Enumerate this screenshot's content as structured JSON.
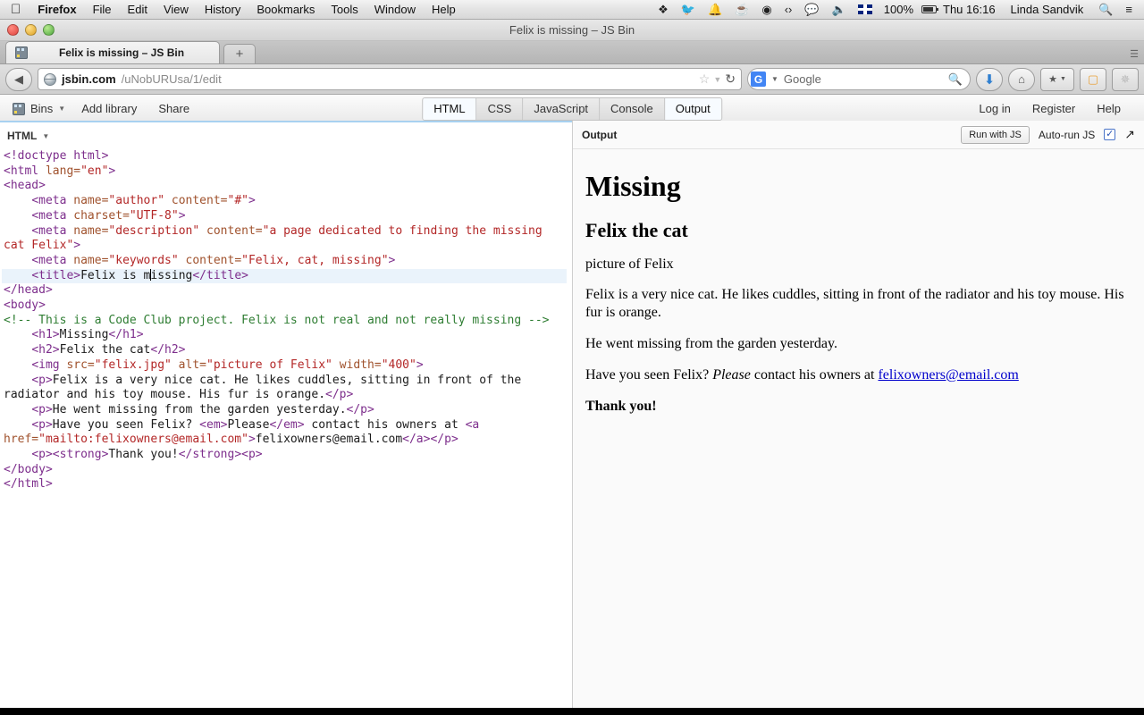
{
  "menubar": {
    "apple_icon": "apple-logo",
    "app_name": "Firefox",
    "items": [
      "File",
      "Edit",
      "View",
      "History",
      "Bookmarks",
      "Tools",
      "Window",
      "Help"
    ],
    "status_icons": [
      "dropbox-icon",
      "twitter-icon",
      "bell-icon",
      "coffee-icon",
      "wifi-icon",
      "code-icon",
      "messages-icon",
      "volume-icon"
    ],
    "input_flag": "uk-flag-icon",
    "battery_percent": "100%",
    "clock": "Thu 16:16",
    "user_name": "Linda Sandvik",
    "search_icon": "spotlight-search-icon",
    "notifications_icon": "notification-center-icon"
  },
  "window": {
    "title": "Felix is missing – JS Bin",
    "tab": {
      "title": "Felix is missing – JS Bin",
      "favicon": "jsbin-favicon"
    },
    "new_tab_label": "+",
    "list_all_tabs": "list-all-tabs-icon"
  },
  "navbar": {
    "back_icon": "back-arrow-icon",
    "site_icon": "globe-icon",
    "url_host": "jsbin.com",
    "url_path": "/uNobURUsa/1/edit",
    "bookmark_icon": "star-icon",
    "bookmark_dropdown_icon": "chevron-down-icon",
    "reload_icon": "reload-icon",
    "search_engine": "G",
    "search_placeholder": "Google",
    "search_value": "",
    "search_submit_icon": "magnifier-icon",
    "downloads_icon": "download-arrow-icon",
    "home_icon": "home-icon",
    "bookmarks_menu_icon": "bookmarks-star-icon",
    "bookmarks_menu_caret": "chevron-down-icon",
    "reader_icon": "reader-ruler-icon",
    "addon_icon": "addon-spinner-icon"
  },
  "jsbin": {
    "bins_label": "Bins",
    "bins_icon": "jsbin-logo-icon",
    "bins_caret": "caret-down-icon",
    "add_library_label": "Add library",
    "share_label": "Share",
    "panel_tabs": [
      {
        "label": "HTML",
        "active": true
      },
      {
        "label": "CSS",
        "active": false
      },
      {
        "label": "JavaScript",
        "active": false
      },
      {
        "label": "Console",
        "active": false
      },
      {
        "label": "Output",
        "active": true
      }
    ],
    "login_label": "Log in",
    "register_label": "Register",
    "help_label": "Help"
  },
  "editor": {
    "panel_label": "HTML",
    "panel_caret": "caret-down-icon",
    "lines": [
      [
        {
          "t": "tag",
          "s": "<!doctype html>"
        }
      ],
      [
        {
          "t": "tag",
          "s": "<html "
        },
        {
          "t": "attr",
          "s": "lang="
        },
        {
          "t": "str",
          "s": "\"en\""
        },
        {
          "t": "tag",
          "s": ">"
        }
      ],
      [
        {
          "t": "tag",
          "s": "<head>"
        }
      ],
      [
        {
          "t": "txt",
          "s": "    "
        },
        {
          "t": "tag",
          "s": "<meta "
        },
        {
          "t": "attr",
          "s": "name="
        },
        {
          "t": "str",
          "s": "\"author\""
        },
        {
          "t": "attr",
          "s": " content="
        },
        {
          "t": "str",
          "s": "\"#\""
        },
        {
          "t": "tag",
          "s": ">"
        }
      ],
      [
        {
          "t": "txt",
          "s": "    "
        },
        {
          "t": "tag",
          "s": "<meta "
        },
        {
          "t": "attr",
          "s": "charset="
        },
        {
          "t": "str",
          "s": "\"UTF-8\""
        },
        {
          "t": "tag",
          "s": ">"
        }
      ],
      [
        {
          "t": "txt",
          "s": "    "
        },
        {
          "t": "tag",
          "s": "<meta "
        },
        {
          "t": "attr",
          "s": "name="
        },
        {
          "t": "str",
          "s": "\"description\""
        },
        {
          "t": "attr",
          "s": " content="
        },
        {
          "t": "str",
          "s": "\"a page dedicated to finding the missing cat Felix\""
        },
        {
          "t": "tag",
          "s": ">"
        }
      ],
      [
        {
          "t": "txt",
          "s": "    "
        },
        {
          "t": "tag",
          "s": "<meta "
        },
        {
          "t": "attr",
          "s": "name="
        },
        {
          "t": "str",
          "s": "\"keywords\""
        },
        {
          "t": "attr",
          "s": " content="
        },
        {
          "t": "str",
          "s": "\"Felix, cat, missing\""
        },
        {
          "t": "tag",
          "s": ">"
        }
      ],
      [
        {
          "t": "txt",
          "s": "    "
        },
        {
          "t": "tag",
          "s": "<title>"
        },
        {
          "t": "txt",
          "s": "Felix is m"
        },
        {
          "t": "caret",
          "s": ""
        },
        {
          "t": "txt",
          "s": "issing"
        },
        {
          "t": "tag",
          "s": "</title>"
        }
      ],
      [
        {
          "t": "tag",
          "s": "</head>"
        }
      ],
      [
        {
          "t": "tag",
          "s": "<body>"
        }
      ],
      [
        {
          "t": "cmt",
          "s": "<!-- This is a Code Club project. Felix is not real and not really missing -->"
        }
      ],
      [
        {
          "t": "txt",
          "s": "    "
        },
        {
          "t": "tag",
          "s": "<h1>"
        },
        {
          "t": "txt",
          "s": "Missing"
        },
        {
          "t": "tag",
          "s": "</h1>"
        }
      ],
      [
        {
          "t": "txt",
          "s": "    "
        },
        {
          "t": "tag",
          "s": "<h2>"
        },
        {
          "t": "txt",
          "s": "Felix the cat"
        },
        {
          "t": "tag",
          "s": "</h2>"
        }
      ],
      [
        {
          "t": "txt",
          "s": "    "
        },
        {
          "t": "tag",
          "s": "<img "
        },
        {
          "t": "attr",
          "s": "src="
        },
        {
          "t": "str",
          "s": "\"felix.jpg\""
        },
        {
          "t": "attr",
          "s": " alt="
        },
        {
          "t": "str",
          "s": "\"picture of Felix\""
        },
        {
          "t": "attr",
          "s": " width="
        },
        {
          "t": "str",
          "s": "\"400\""
        },
        {
          "t": "tag",
          "s": ">"
        }
      ],
      [
        {
          "t": "txt",
          "s": "    "
        },
        {
          "t": "tag",
          "s": "<p>"
        },
        {
          "t": "txt",
          "s": "Felix is a very nice cat. He likes cuddles, sitting in front of the radiator and his toy mouse. His fur is orange."
        },
        {
          "t": "tag",
          "s": "</p>"
        }
      ],
      [
        {
          "t": "txt",
          "s": "    "
        },
        {
          "t": "tag",
          "s": "<p>"
        },
        {
          "t": "txt",
          "s": "He went missing from the garden yesterday."
        },
        {
          "t": "tag",
          "s": "</p>"
        }
      ],
      [
        {
          "t": "txt",
          "s": "    "
        },
        {
          "t": "tag",
          "s": "<p>"
        },
        {
          "t": "txt",
          "s": "Have you seen Felix? "
        },
        {
          "t": "tag",
          "s": "<em>"
        },
        {
          "t": "txt",
          "s": "Please"
        },
        {
          "t": "tag",
          "s": "</em>"
        },
        {
          "t": "txt",
          "s": " contact his owners at "
        },
        {
          "t": "tag",
          "s": "<a "
        },
        {
          "t": "attr",
          "s": "href="
        },
        {
          "t": "str",
          "s": "\"mailto:felixowners@email.com\""
        },
        {
          "t": "tag",
          "s": ">"
        },
        {
          "t": "txt",
          "s": "felixowners@email.com"
        },
        {
          "t": "tag",
          "s": "</a>"
        },
        {
          "t": "tag",
          "s": "</p>"
        }
      ],
      [
        {
          "t": "txt",
          "s": "    "
        },
        {
          "t": "tag",
          "s": "<p>"
        },
        {
          "t": "tag",
          "s": "<strong>"
        },
        {
          "t": "txt",
          "s": "Thank you!"
        },
        {
          "t": "tag",
          "s": "</strong>"
        },
        {
          "t": "tag",
          "s": "<p>"
        }
      ],
      [
        {
          "t": "tag",
          "s": "</body>"
        }
      ],
      [
        {
          "t": "tag",
          "s": "</html>"
        }
      ]
    ],
    "active_line_index": 7
  },
  "output": {
    "panel_label": "Output",
    "run_with_js_label": "Run with JS",
    "auto_run_label": "Auto-run JS",
    "auto_run_checked": true,
    "check_glyph": "✓",
    "expand_icon": "expand-arrow-icon",
    "page": {
      "h1": "Missing",
      "h2": "Felix the cat",
      "image_alt": "picture of Felix",
      "paragraph_1": "Felix is a very nice cat. He likes cuddles, sitting in front of the radiator and his toy mouse. His fur is orange.",
      "paragraph_2": "He went missing from the garden yesterday.",
      "paragraph_3_pre": "Have you seen Felix? ",
      "paragraph_3_em": "Please",
      "paragraph_3_mid": " contact his owners at ",
      "paragraph_3_link": "felixowners@email.com",
      "thank_you": "Thank you!"
    }
  },
  "colors": {
    "accent_blue": "#4285f4",
    "link_blue": "#0000cc",
    "active_line": "#eaf3fb",
    "tag": "#7d2e8c",
    "attr": "#a0522d",
    "string": "#b32727",
    "comment": "#2e7d32"
  }
}
